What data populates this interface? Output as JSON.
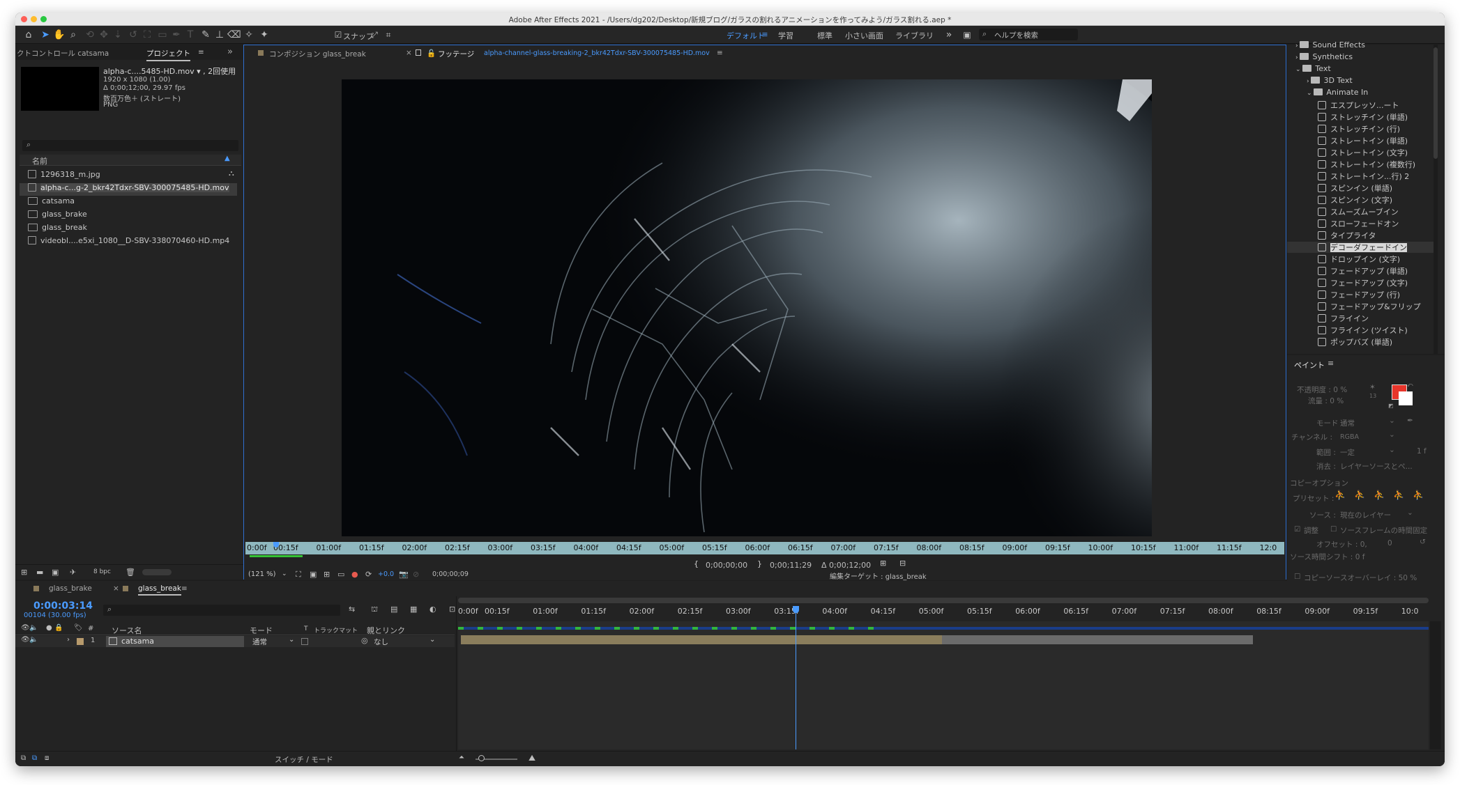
{
  "window": {
    "title": "Adobe After Effects 2021 - /Users/dg202/Desktop/新規ブログ/ガラスの割れるアニメーションを作ってみよう/ガラス割れる.aep *"
  },
  "toolbar": {
    "snap_label": "スナップ",
    "workspaces": [
      "デフォルト",
      "学習",
      "標準",
      "小さい画面",
      "ライブラリ"
    ],
    "active_workspace": "デフォルト",
    "help_search_placeholder": "ヘルプを検索"
  },
  "project_panel": {
    "tab_effect_controls": "クトコントロール catsama",
    "tab_project": "プロジェクト",
    "selected_name": "alpha-c....5485-HD.mov ▾ , 2回使用",
    "selected_info": [
      "1920 x 1080 (1.00)",
      "Δ 0;00;12;00, 29.97 fps",
      "数百万色＋ (ストレート)",
      "PNG"
    ],
    "search_placeholder": "",
    "column_name": "名前",
    "items": [
      {
        "name": "1296318_m.jpg",
        "type": "image"
      },
      {
        "name": "alpha-c...g-2_bkr42Tdxr-SBV-300075485-HD.mov",
        "type": "footage",
        "selected": true
      },
      {
        "name": "catsama",
        "type": "comp"
      },
      {
        "name": "glass_brake",
        "type": "comp"
      },
      {
        "name": "glass_break",
        "type": "comp"
      },
      {
        "name": "videobl....e5xi_1080__D-SBV-338070460-HD.mp4",
        "type": "footage"
      }
    ],
    "bpc": "8 bpc"
  },
  "viewer": {
    "tab_comp": "コンポジション glass_break",
    "tab_footage_label": "フッテージ",
    "tab_footage_name": "alpha-channel-glass-breaking-2_bkr42Tdxr-SBV-300075485-HD.mov",
    "ruler_ticks": [
      "0:00f",
      "00:15f",
      "01:00f",
      "01:15f",
      "02:00f",
      "02:15f",
      "03:00f",
      "03:15f",
      "04:00f",
      "04:15f",
      "05:00f",
      "05:15f",
      "06:00f",
      "06:15f",
      "07:00f",
      "07:15f",
      "08:00f",
      "08:15f",
      "09:00f",
      "09:15f",
      "10:00f",
      "10:15f",
      "11:00f",
      "11:15f",
      "12:0"
    ],
    "in_point": "0;00;00;00",
    "out_point": "0;00;11;29",
    "duration": "Δ 0;00;12;00",
    "zoom": "(121 %)",
    "exposure": "+0.0",
    "current_time": "0;00;00;09",
    "edit_target": "編集ターゲット : glass_break"
  },
  "effects_panel": {
    "rows": [
      {
        "label": "Sound Effects",
        "kind": "folder",
        "indent": 1
      },
      {
        "label": "Synthetics",
        "kind": "folder",
        "indent": 1
      },
      {
        "label": "Text",
        "kind": "folder-open",
        "indent": 1
      },
      {
        "label": "3D Text",
        "kind": "folder",
        "indent": 2
      },
      {
        "label": "Animate In",
        "kind": "folder-open",
        "indent": 2
      },
      {
        "label": "エスプレッソ...ート",
        "kind": "preset",
        "indent": 3
      },
      {
        "label": "ストレッチイン (単語)",
        "kind": "preset",
        "indent": 3
      },
      {
        "label": "ストレッチイン (行)",
        "kind": "preset",
        "indent": 3
      },
      {
        "label": "ストレートイン (単語)",
        "kind": "preset",
        "indent": 3
      },
      {
        "label": "ストレートイン (文字)",
        "kind": "preset",
        "indent": 3
      },
      {
        "label": "ストレートイン (複数行)",
        "kind": "preset",
        "indent": 3
      },
      {
        "label": "ストレートイン...行) 2",
        "kind": "preset",
        "indent": 3
      },
      {
        "label": "スピンイン (単語)",
        "kind": "preset",
        "indent": 3
      },
      {
        "label": "スピンイン (文字)",
        "kind": "preset",
        "indent": 3
      },
      {
        "label": "スムーズムーブイン",
        "kind": "preset",
        "indent": 3
      },
      {
        "label": "スローフェードオン",
        "kind": "preset",
        "indent": 3
      },
      {
        "label": "タイプライタ",
        "kind": "preset",
        "indent": 3
      },
      {
        "label": "デコーダフェードイン",
        "kind": "preset",
        "indent": 3,
        "selected": true
      },
      {
        "label": "ドロップイン (文字)",
        "kind": "preset",
        "indent": 3
      },
      {
        "label": "フェードアップ (単語)",
        "kind": "preset",
        "indent": 3
      },
      {
        "label": "フェードアップ (文字)",
        "kind": "preset",
        "indent": 3
      },
      {
        "label": "フェードアップ (行)",
        "kind": "preset",
        "indent": 3
      },
      {
        "label": "フェードアップ&フリップ",
        "kind": "preset",
        "indent": 3
      },
      {
        "label": "フライイン",
        "kind": "preset",
        "indent": 3
      },
      {
        "label": "フライイン (ツイスト)",
        "kind": "preset",
        "indent": 3
      },
      {
        "label": "ポップバズ (単語)",
        "kind": "preset",
        "indent": 3
      }
    ]
  },
  "paint_panel": {
    "title": "ペイント",
    "opacity": "不透明度 : 0 %",
    "flow": "流量 : 0 %",
    "brush_size": "13",
    "mode_label": "モード :",
    "mode_value": "通常",
    "channel_label": "チャンネル :",
    "channel_value": "RGBA",
    "duration_label": "範囲 :",
    "duration_value": "一定",
    "duration_frames": "1 f",
    "erase_label": "消去 :",
    "erase_value": "レイヤーソースとペ...",
    "clone_options": "コピーオプション",
    "preset_label": "プリセット :",
    "source_label": "ソース :",
    "source_value": "現在のレイヤー",
    "aligned": "調整",
    "lock_source_time": "ソースフレームの時間固定",
    "offset_label": "オフセット : 0,",
    "offset_value": "0",
    "source_time_shift": "ソース時間シフト : 0 f",
    "clone_overlay": "コピーソースオーバーレイ : 50 %",
    "fg_color": "#e8352b",
    "bg_color": "#ffffff"
  },
  "timeline": {
    "tab_1": "glass_brake",
    "tab_2": "glass_break",
    "current_time": "0:00:03:14",
    "frame_info": "00104 (30.00 fps)",
    "col_source": "ソース名",
    "col_mode": "モード",
    "col_t": "T",
    "col_trackmatte": "トラックマット",
    "col_parent": "親とリンク",
    "col_hash": "#",
    "layer_index": "1",
    "layer_name": "catsama",
    "layer_mode": "通常",
    "layer_parent": "なし",
    "ruler_ticks": [
      "0:00f",
      "00:15f",
      "01:00f",
      "01:15f",
      "02:00f",
      "02:15f",
      "03:00f",
      "03:15f",
      "04:00f",
      "04:15f",
      "05:00f",
      "05:15f",
      "06:00f",
      "06:15f",
      "07:00f",
      "07:15f",
      "08:00f",
      "08:15f",
      "09:00f",
      "09:15f",
      "10:0"
    ],
    "switch_mode": "スイッチ / モード",
    "playhead_seconds": 3.47
  }
}
